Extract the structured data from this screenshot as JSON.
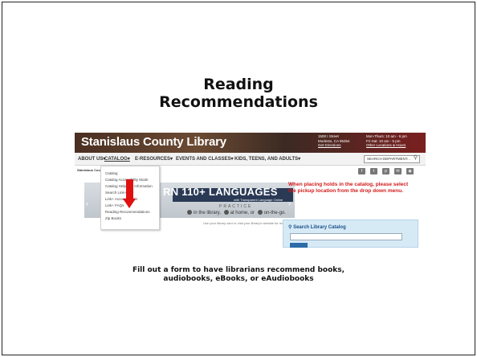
{
  "slide": {
    "title_line1": "Reading",
    "title_line2": "Recommendations",
    "caption_line1": "Fill out a form to have librarians recommend books,",
    "caption_line2": "audiobooks, eBooks, or eAudiobooks"
  },
  "screenshot": {
    "logo": "Stanislaus County Library",
    "address": {
      "line1": "1500 I Street",
      "line2": "Modesto, CA 95354",
      "link": "Get Directions"
    },
    "hours": {
      "line1": "Mon-Thurs: 10 am - 6 pm",
      "line2": "Fri-Sat: 10 am - 5 pm",
      "link": "Other Locations & Hours"
    },
    "nav": {
      "items": [
        "ABOUT US▾",
        "CATALOG▾",
        "E-RESOURCES▾",
        "EVENTS AND CLASSES▾",
        "KIDS, TEENS, AND ADULTS▾"
      ],
      "search_label": "SEARCH DEPARTMENT..."
    },
    "breadcrumb": "Stanislaus County ▾",
    "social_icons": [
      "facebook-icon",
      "twitter-icon",
      "pinterest-icon",
      "email-icon",
      "rss-icon"
    ],
    "social_glyphs": [
      "f",
      "t",
      "p",
      "✉",
      "◉"
    ],
    "banner": {
      "headline": "RN 110+ LANGUAGES",
      "sub": "with Transparent Language Online",
      "practice": "PRACTICE",
      "row_parts": [
        "in the library,",
        "at home, or",
        "on-the-go."
      ],
      "small": "Use your library card or visit your library's website for more details."
    },
    "dropdown": {
      "items": [
        "Catalog",
        "Catalog Accessibility Mode",
        "Catalog Help And Information",
        "Search Link+",
        "Link+ Account Login",
        "Link+ FAQs",
        "Reading Recommendations",
        "Zip Books"
      ]
    },
    "notice": "When placing holds in the catalog, please select the pickup location from the drop down menu.",
    "search_catalog": {
      "title": "Search Library Catalog"
    },
    "colors": {
      "notice_red": "#d21a1a",
      "arrow_red": "#e01010",
      "search_box_bg": "#d6eaf6"
    }
  }
}
